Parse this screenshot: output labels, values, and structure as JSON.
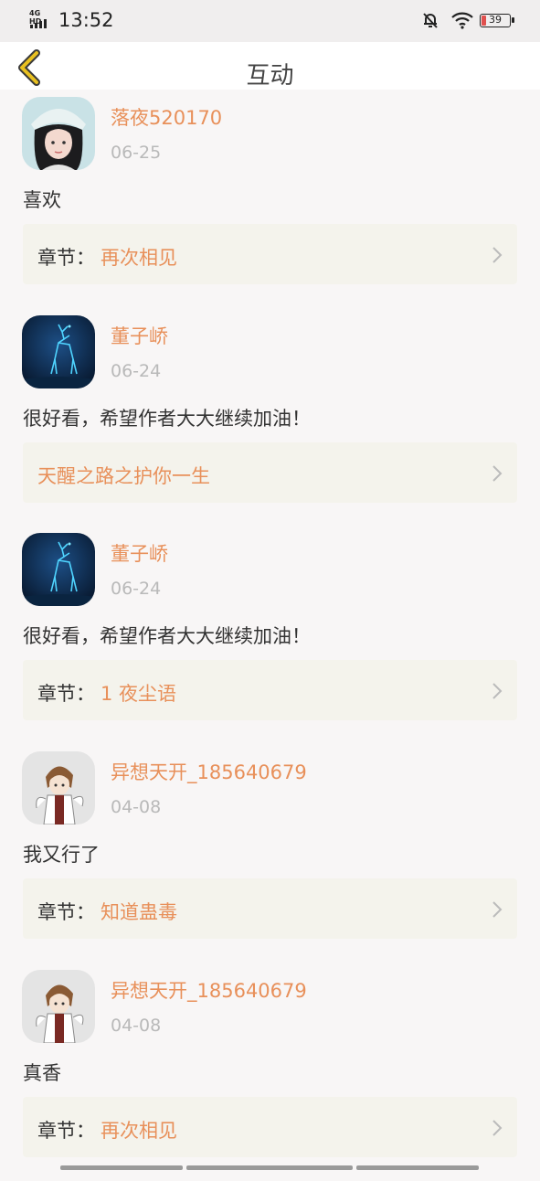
{
  "status_bar": {
    "network": "4G HD",
    "time": "13:52",
    "battery": "39",
    "icons": [
      "mute-bell-icon",
      "wifi-icon",
      "battery-icon"
    ]
  },
  "nav": {
    "back_icon": "chevron-left-icon",
    "title": "互动"
  },
  "colors": {
    "accent": "#e8905a",
    "back_icon": "#e8c020",
    "card_bg": "#f4f3ec"
  },
  "comments": [
    {
      "username": "落夜520170",
      "date": "06-25",
      "content": "喜欢",
      "chapter_label": "章节：",
      "chapter": "再次相见",
      "avatar": "girl-avatar"
    },
    {
      "username": "董子峤",
      "date": "06-24",
      "content": "很好看，希望作者大大继续加油！",
      "chapter_label": "",
      "chapter": "天醒之路之护你一生",
      "avatar": "deer-avatar"
    },
    {
      "username": "董子峤",
      "date": "06-24",
      "content": "很好看，希望作者大大继续加油！",
      "chapter_label": "章节：",
      "chapter": "1 夜尘语",
      "avatar": "deer-avatar"
    },
    {
      "username": "异想天开_185640679",
      "date": "04-08",
      "content": "我又行了",
      "chapter_label": "章节：",
      "chapter": "知道蛊毒",
      "avatar": "anime-boy-avatar"
    },
    {
      "username": "异想天开_185640679",
      "date": "04-08",
      "content": "真香",
      "chapter_label": "章节：",
      "chapter": "再次相见",
      "avatar": "anime-boy-avatar"
    }
  ]
}
